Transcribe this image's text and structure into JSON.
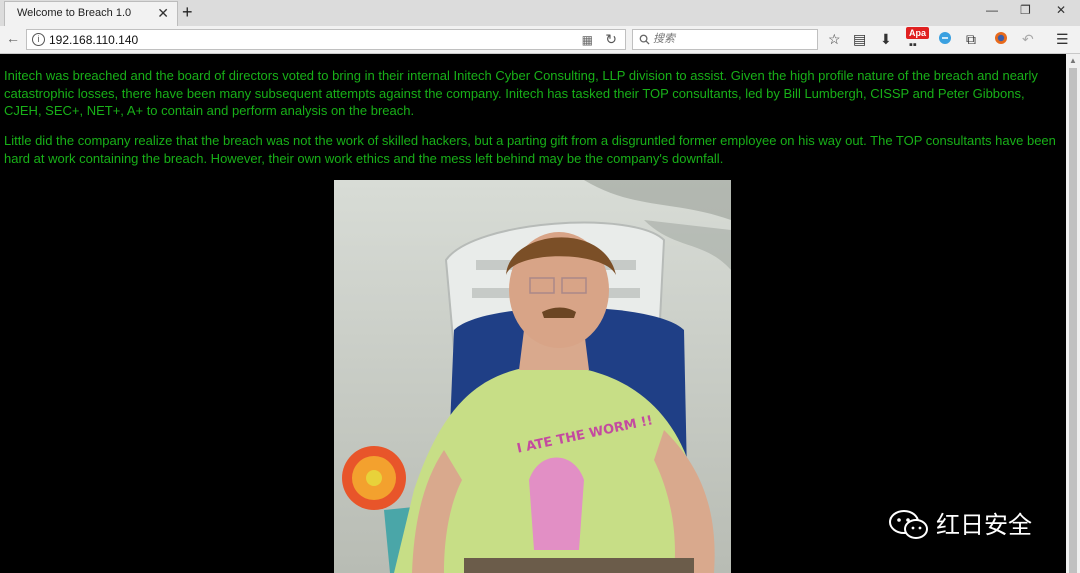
{
  "window": {
    "tab_title": "Welcome to Breach 1.0",
    "tab_close_glyph": "✕",
    "new_tab_glyph": "+",
    "minimize_glyph": "—",
    "restore_glyph": "❐",
    "close_glyph": "✕"
  },
  "navbar": {
    "back_glyph": "←",
    "url": "192.168.110.140",
    "search_placeholder": "搜索",
    "extension_badge": "Apa"
  },
  "page": {
    "text_color": "#18b018",
    "background_color": "#000000",
    "paragraphs": [
      "Initech was breached and the board of directors voted to bring in their internal Initech Cyber Consulting, LLP division to assist. Given the high profile nature of the breach and nearly catastrophic losses, there have been many subsequent attempts against the company. Initech has tasked their TOP consultants, led by Bill Lumbergh, CISSP and Peter Gibbons, CJEH, SEC+, NET+, A+ to contain and perform analysis on the breach.",
      "Little did the company realize that the breach was not the work of skilled hackers, but a parting gift from a disgruntled former employee on his way out. The TOP consultants have been hard at work containing the breach. However, their own work ethics and the mess left behind may be the company's downfall."
    ],
    "shirt_text": "I ATE THE WORM !!"
  },
  "watermark": {
    "text": "红日安全",
    "icon": "wechat-icon"
  },
  "icons": [
    "info-icon",
    "qr-code-icon",
    "reload-icon",
    "search-icon",
    "bookmark-star-icon",
    "reader-icon",
    "download-icon",
    "extension-icon",
    "sync-icon",
    "screenshot-icon",
    "firefox-icon",
    "undo-icon",
    "menu-icon"
  ]
}
